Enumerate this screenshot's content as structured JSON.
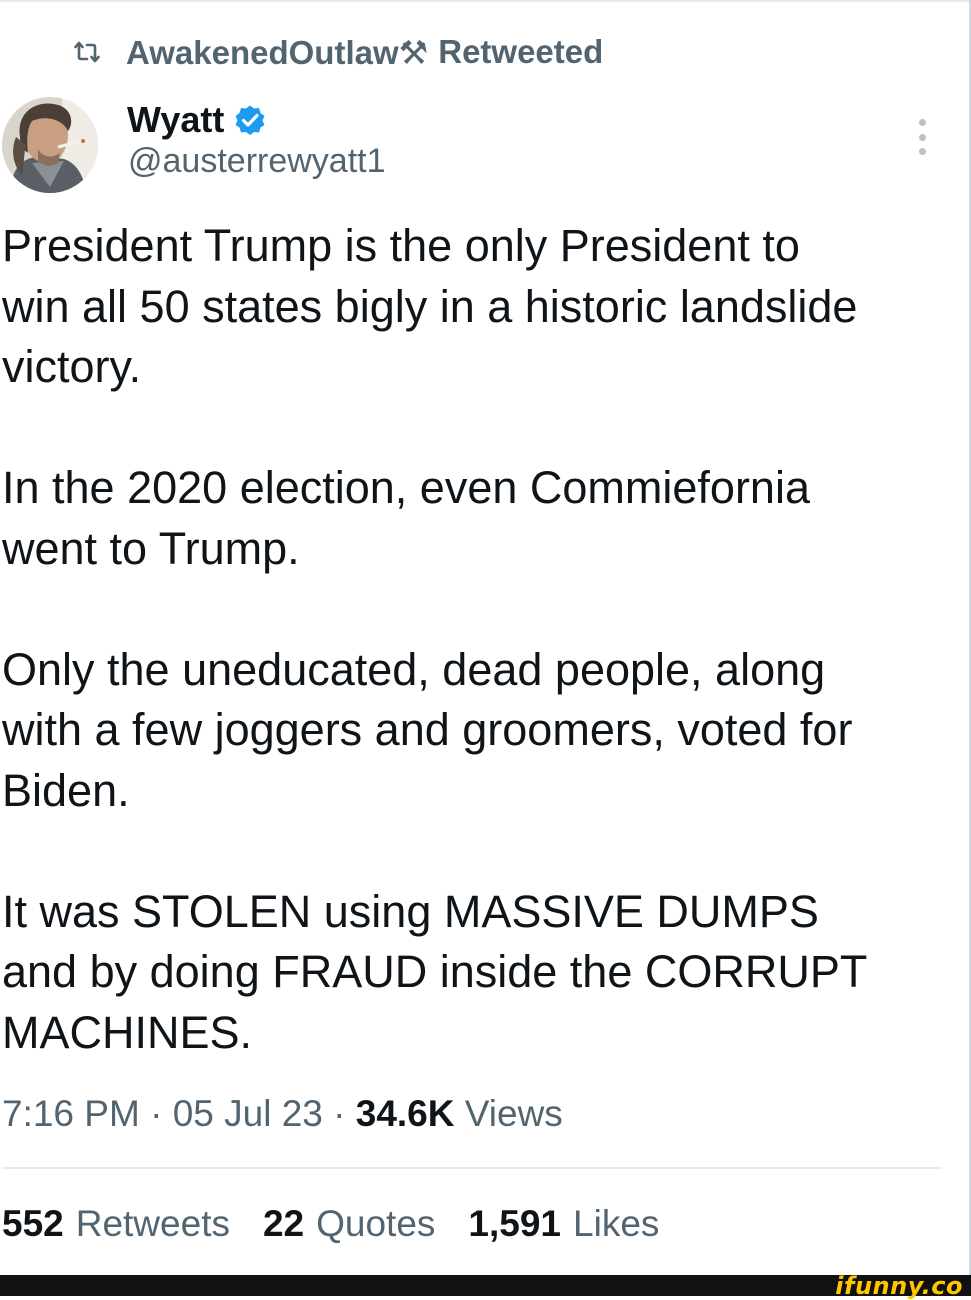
{
  "retweet_banner": {
    "icon": "retweet-icon",
    "user": "AwakenedOutlaw⚒",
    "action": "Retweeted"
  },
  "author": {
    "display_name": "Wyatt",
    "handle": "@austerrewyatt1",
    "verified_icon": "verified-badge-icon",
    "badge_color": "#1d9bf0"
  },
  "tweet": {
    "paragraphs": [
      "President Trump is the only President to\nwin all 50 states bigly in a historic landslide\nvictory.",
      "In the 2020 election, even Commiefornia\nwent to Trump.",
      "Only the uneducated, dead people, along\nwith a few joggers and groomers, voted for\nBiden.",
      "It was STOLEN using MASSIVE DUMPS\nand by doing FRAUD inside the CORRUPT\nMACHINES."
    ]
  },
  "meta": {
    "time": "7:16 PM",
    "separator": "·",
    "date": "05 Jul 23",
    "views_count": "34.6K",
    "views_label": "Views"
  },
  "stats": {
    "retweets_count": "552",
    "retweets_label": "Retweets",
    "quotes_count": "22",
    "quotes_label": "Quotes",
    "likes_count": "1,591",
    "likes_label": "Likes"
  },
  "watermark": {
    "text": "ifunny.co",
    "color": "#ffc600"
  }
}
